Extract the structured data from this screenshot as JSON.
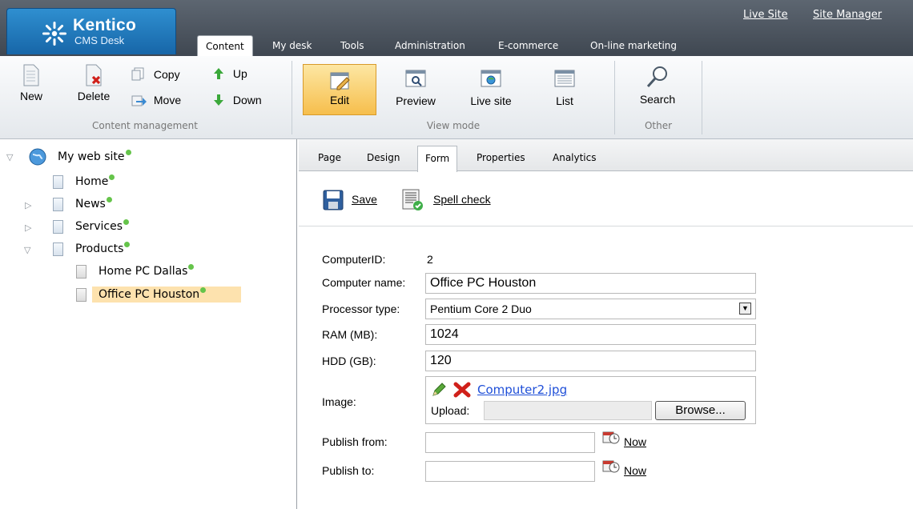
{
  "header": {
    "brand": "Kentico",
    "product": "CMS Desk",
    "top_links": [
      "Live Site",
      "Site Manager"
    ],
    "tabs": [
      "Content",
      "My desk",
      "Tools",
      "Administration",
      "E-commerce",
      "On-line marketing"
    ],
    "active_tab": "Content"
  },
  "ribbon": {
    "content_management": {
      "label": "Content management",
      "new": "New",
      "delete": "Delete",
      "copy": "Copy",
      "move": "Move",
      "up": "Up",
      "down": "Down"
    },
    "view_mode": {
      "label": "View mode",
      "edit": "Edit",
      "preview": "Preview",
      "live_site": "Live site",
      "list": "List"
    },
    "other": {
      "label": "Other",
      "search": "Search"
    }
  },
  "tree": {
    "root": "My web site",
    "items": [
      "Home",
      "News",
      "Services",
      "Products",
      "Home PC Dallas",
      "Office PC Houston"
    ],
    "selected": "Office PC Houston"
  },
  "subtabs": [
    "Page",
    "Design",
    "Form",
    "Properties",
    "Analytics"
  ],
  "active_subtab": "Form",
  "actions": {
    "save": "Save",
    "spell_check": "Spell check"
  },
  "form": {
    "computer_id_label": "ComputerID:",
    "computer_id": "2",
    "computer_name_label": "Computer name:",
    "computer_name": "Office PC Houston",
    "processor_type_label": "Processor type:",
    "processor_type": "Pentium Core 2 Duo",
    "ram_label": "RAM (MB):",
    "ram": "1024",
    "hdd_label": "HDD (GB):",
    "hdd": "120",
    "image_label": "Image:",
    "image_file": "Computer2.jpg",
    "upload_label": "Upload:",
    "browse": "Browse...",
    "publish_from_label": "Publish from:",
    "publish_to_label": "Publish to:",
    "now": "Now"
  },
  "colors": {
    "header_bg": "#4b535d",
    "logo_blue": "#1e77bd",
    "edit_highlight": "#f6be4c",
    "tree_selected": "#fde2ae",
    "status_dot": "#65c44a"
  }
}
